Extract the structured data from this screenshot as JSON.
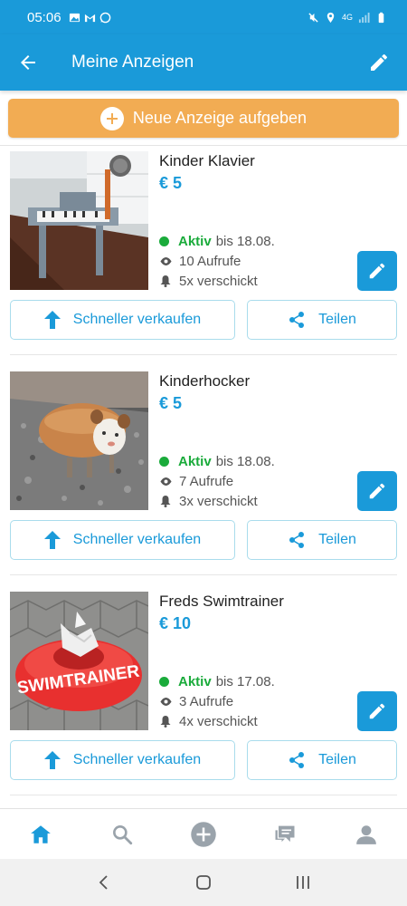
{
  "status_bar": {
    "time": "05:06",
    "network": "4G"
  },
  "header": {
    "title": "Meine Anzeigen"
  },
  "new_ad_button": {
    "label": "Neue Anzeige aufgeben"
  },
  "listings": [
    {
      "title": "Kinder Klavier",
      "price": "€ 5",
      "status": "Aktiv",
      "until": "bis 18.08.",
      "views": "10 Aufrufe",
      "sent": "5x verschickt",
      "sell_label": "Schneller verkaufen",
      "share_label": "Teilen"
    },
    {
      "title": "Kinderhocker",
      "price": "€ 5",
      "status": "Aktiv",
      "until": "bis 18.08.",
      "views": "7 Aufrufe",
      "sent": "3x verschickt",
      "sell_label": "Schneller verkaufen",
      "share_label": "Teilen"
    },
    {
      "title": "Freds Swimtrainer",
      "price": "€ 10",
      "status": "Aktiv",
      "until": "bis 17.08.",
      "views": "3 Aufrufe",
      "sent": "4x verschickt",
      "sell_label": "Schneller verkaufen",
      "share_label": "Teilen",
      "image_text": "SWIMTRAINER"
    }
  ],
  "bottom_nav": [
    "home-icon",
    "search-icon",
    "add-icon",
    "messages-icon",
    "profile-icon"
  ],
  "colors": {
    "primary": "#1a9ad9",
    "accent": "#f2ac53",
    "active": "#1aab3b"
  }
}
